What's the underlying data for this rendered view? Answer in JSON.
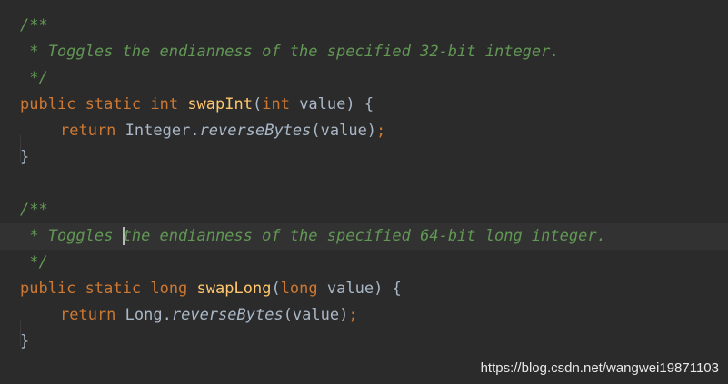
{
  "colors": {
    "background": "#2b2b2b",
    "current_line": "#323232",
    "comment": "#629755",
    "keyword": "#cc7832",
    "function_name": "#ffc66d",
    "identifier": "#a9b7c6"
  },
  "code": {
    "block1": {
      "doc_open": "/**",
      "doc_text": " * Toggles the endianness of the specified 32-bit integer.",
      "doc_close": " */",
      "kw_public": "public",
      "kw_static": "static",
      "kw_return_type": "int",
      "method_name": "swapInt",
      "open_paren": "(",
      "param_type": "int",
      "param_name": "value",
      "close_paren_brace": ") {",
      "kw_return": "return",
      "call_target": "Integer.",
      "call_method": "reverseBytes",
      "call_args": "(value)",
      "semicolon": ";",
      "close_brace": "}"
    },
    "block2": {
      "doc_open": "/**",
      "doc_prefix": " * Toggles ",
      "doc_rest": "the endianness of the specified 64-bit long integer.",
      "doc_close": " */",
      "kw_public": "public",
      "kw_static": "static",
      "kw_return_type": "long",
      "method_name": "swapLong",
      "open_paren": "(",
      "param_type": "long",
      "param_name": "value",
      "close_paren_brace": ") {",
      "kw_return": "return",
      "call_target": "Long.",
      "call_method": "reverseBytes",
      "call_args": "(value)",
      "semicolon": ";",
      "close_brace": "}"
    }
  },
  "watermark": "https://blog.csdn.net/wangwei19871103"
}
